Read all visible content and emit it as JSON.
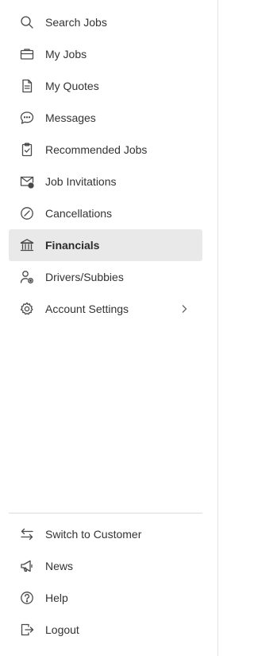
{
  "sidebar": {
    "items": [
      {
        "label": "Search Jobs",
        "icon": "search-icon"
      },
      {
        "label": "My Jobs",
        "icon": "briefcase-icon"
      },
      {
        "label": "My Quotes",
        "icon": "document-icon"
      },
      {
        "label": "Messages",
        "icon": "chat-bubble-icon"
      },
      {
        "label": "Recommended Jobs",
        "icon": "clipboard-check-icon"
      },
      {
        "label": "Job Invitations",
        "icon": "envelope-badge-icon"
      },
      {
        "label": "Cancellations",
        "icon": "cancel-circle-icon"
      },
      {
        "label": "Financials",
        "icon": "bank-icon",
        "active": true
      },
      {
        "label": "Drivers/Subbies",
        "icon": "user-settings-icon"
      },
      {
        "label": "Account Settings",
        "icon": "gear-icon",
        "has_submenu": true
      }
    ],
    "bottom_items": [
      {
        "label": "Switch to Customer",
        "icon": "switch-arrows-icon"
      },
      {
        "label": "News",
        "icon": "megaphone-icon"
      },
      {
        "label": "Help",
        "icon": "help-circle-icon"
      },
      {
        "label": "Logout",
        "icon": "logout-icon"
      }
    ]
  },
  "colors": {
    "active_background": "#e9e9e9",
    "text": "#333333",
    "icon": "#4a4a4a",
    "divider": "#dcdcdc"
  }
}
